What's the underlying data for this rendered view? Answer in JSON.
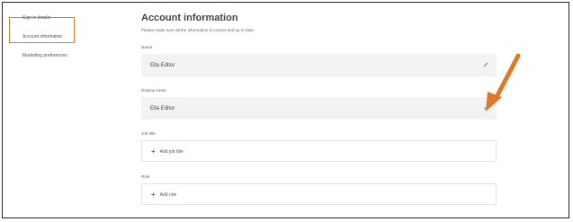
{
  "sidebar": {
    "items": [
      {
        "label": "Sign in details"
      },
      {
        "label": "Account information"
      },
      {
        "label": "Marketing preferences"
      }
    ]
  },
  "main": {
    "title": "Account information",
    "subtitle": "Please make sure all the information is correct and up to date.",
    "fields": [
      {
        "label": "Name",
        "value": "Ella Editor"
      },
      {
        "label": "Display name",
        "value": "Ella Editor"
      },
      {
        "label": "Job title",
        "action": "Add job title"
      },
      {
        "label": "Role",
        "action": "Add role"
      }
    ]
  },
  "colors": {
    "accent": "#e0782a",
    "edit_icon": "#3fa372",
    "field_fill": "#f3f3f3"
  },
  "icons": {
    "edit": "pencil-icon",
    "add": "plus-icon"
  }
}
